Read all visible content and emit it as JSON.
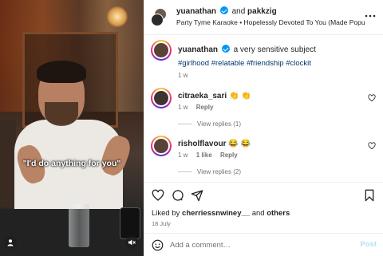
{
  "media": {
    "caption_overlay": "\"I'd do anything for you\"",
    "user_tag_icon": "user-icon",
    "mute_icon": "speaker-muted-icon"
  },
  "header": {
    "user1": "yuanathan",
    "joiner": "and",
    "user2": "pakkzig",
    "audio": "Party Tyme Karaoke • Hopelessly Devoted To You (Made Popular By Olivi",
    "more_icon": "more-icon"
  },
  "caption": {
    "username": "yuanathan",
    "text": "a very sensitive subject",
    "hashtags": "#girlhood #relatable #friendship #clockit",
    "time": "1 w"
  },
  "comments": [
    {
      "username": "citraeka_sari",
      "text": "👏 👏",
      "time": "1 w",
      "likes": "",
      "reply_label": "Reply",
      "view_replies": "View replies (1)"
    },
    {
      "username": "risholflavour",
      "text": "😂 😂",
      "time": "1 w",
      "likes": "1 like",
      "reply_label": "Reply",
      "view_replies": "View replies (2)"
    }
  ],
  "actions": {
    "like_icon": "heart-icon",
    "comment_icon": "comment-icon",
    "share_icon": "share-icon",
    "save_icon": "bookmark-icon"
  },
  "likes": {
    "prefix": "Liked by",
    "user": "cherriessnwiney__",
    "joiner": "and",
    "others": "others"
  },
  "post_date": "18 July",
  "add_comment": {
    "placeholder": "Add a comment…",
    "post_label": "Post",
    "emoji_icon": "emoji-icon"
  },
  "colors": {
    "verified": "#0095f6",
    "hashtag": "#00376b",
    "post_disabled": "#b2dffc",
    "muted_text": "#737373"
  }
}
